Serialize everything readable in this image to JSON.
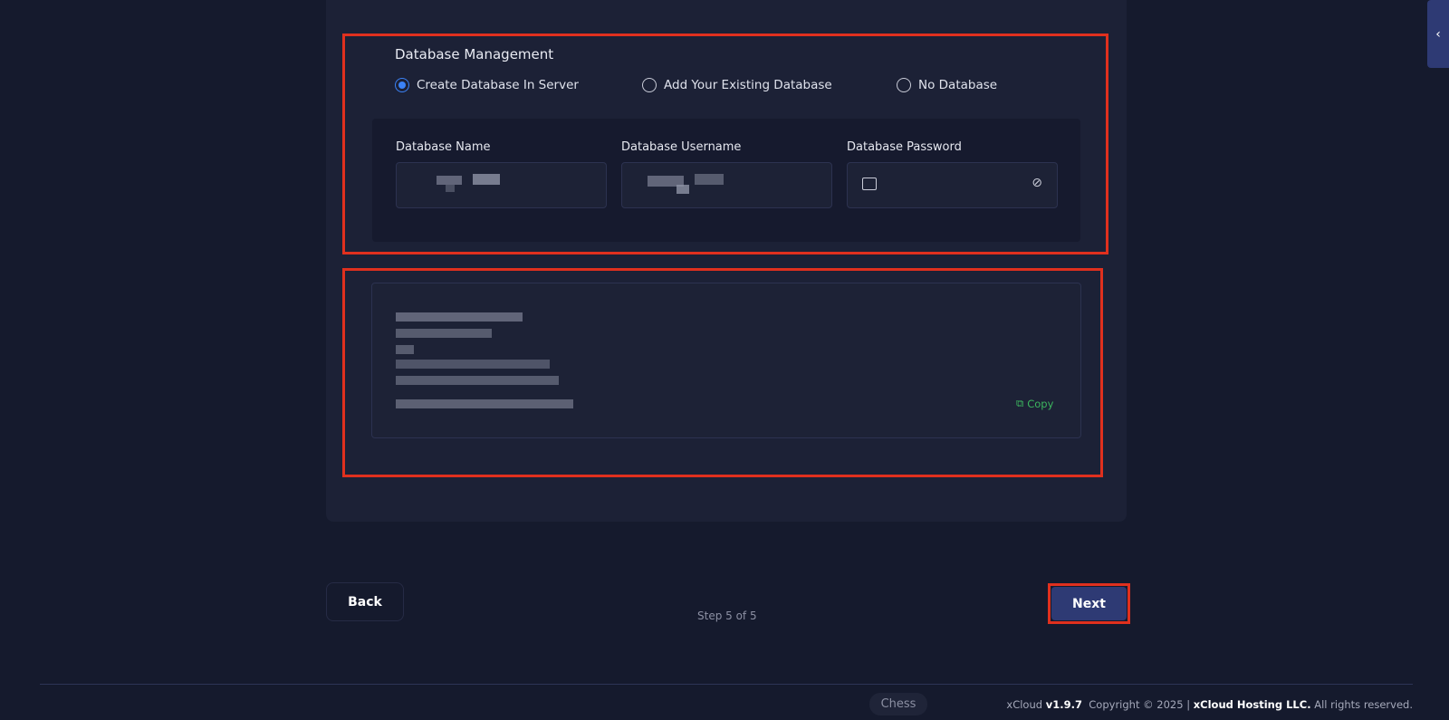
{
  "db": {
    "title": "Database Management",
    "options": [
      {
        "label": "Create Database In Server",
        "selected": true
      },
      {
        "label": "Add Your Existing Database",
        "selected": false
      },
      {
        "label": "No Database",
        "selected": false
      }
    ],
    "fields": {
      "name_label": "Database Name",
      "username_label": "Database Username",
      "password_label": "Database Password"
    }
  },
  "code": {
    "copy_label": "Copy"
  },
  "nav": {
    "back": "Back",
    "next": "Next",
    "step": "Step 5 of 5"
  },
  "footer": {
    "chess": "Chess",
    "brand": "xCloud",
    "version": "v1.9.7",
    "copyright": "Copyright © 2025 |",
    "company": "xCloud Hosting LLC.",
    "rights": "All rights reserved."
  },
  "colors": {
    "accent": "#3b82f6",
    "primary_button": "#2e3a74",
    "copy": "#3cb55e",
    "highlight": "#e0301e"
  }
}
